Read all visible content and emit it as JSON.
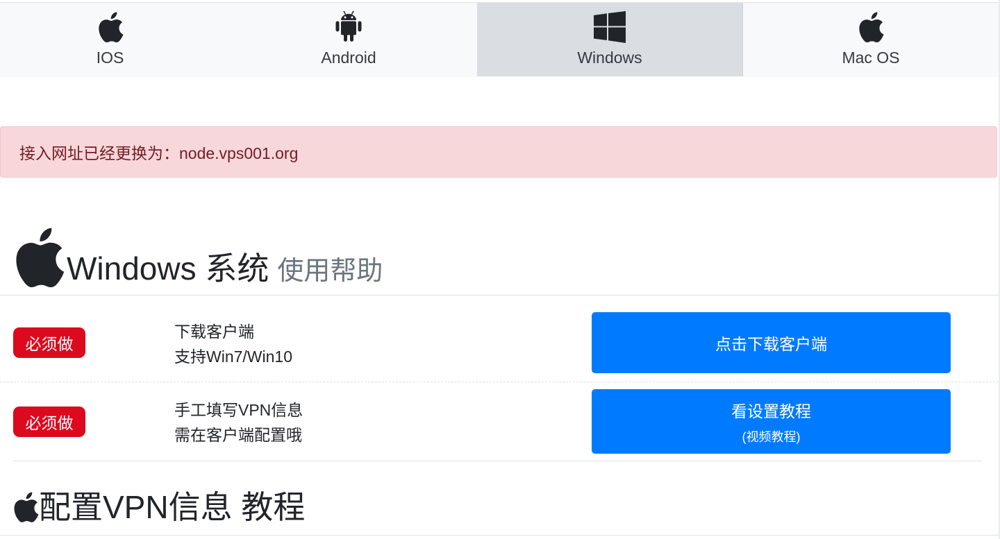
{
  "tabs": [
    {
      "label": "IOS",
      "icon": "apple-icon",
      "active": false
    },
    {
      "label": "Android",
      "icon": "android-icon",
      "active": false
    },
    {
      "label": "Windows",
      "icon": "windows-icon",
      "active": true
    },
    {
      "label": "Mac OS",
      "icon": "apple-icon",
      "active": false
    }
  ],
  "alert": {
    "text": "接入网址已经更换为：node.vps001.org"
  },
  "section": {
    "title": "Windows 系统",
    "subtitle": "使用帮助"
  },
  "steps": [
    {
      "badge": "必须做",
      "line1": "下载客户端",
      "line2": "支持Win7/Win10",
      "button": "点击下载客户端",
      "button_sub": ""
    },
    {
      "badge": "必须做",
      "line1": "手工填写VPN信息",
      "line2": "需在客户端配置哦",
      "button": "看设置教程",
      "button_sub": "(视频教程)"
    }
  ],
  "section2": {
    "title": "配置VPN信息 教程"
  },
  "colors": {
    "primary": "#007bff",
    "danger": "#dc0a1e",
    "alert_bg": "#f8d7da",
    "alert_text": "#721c24"
  }
}
